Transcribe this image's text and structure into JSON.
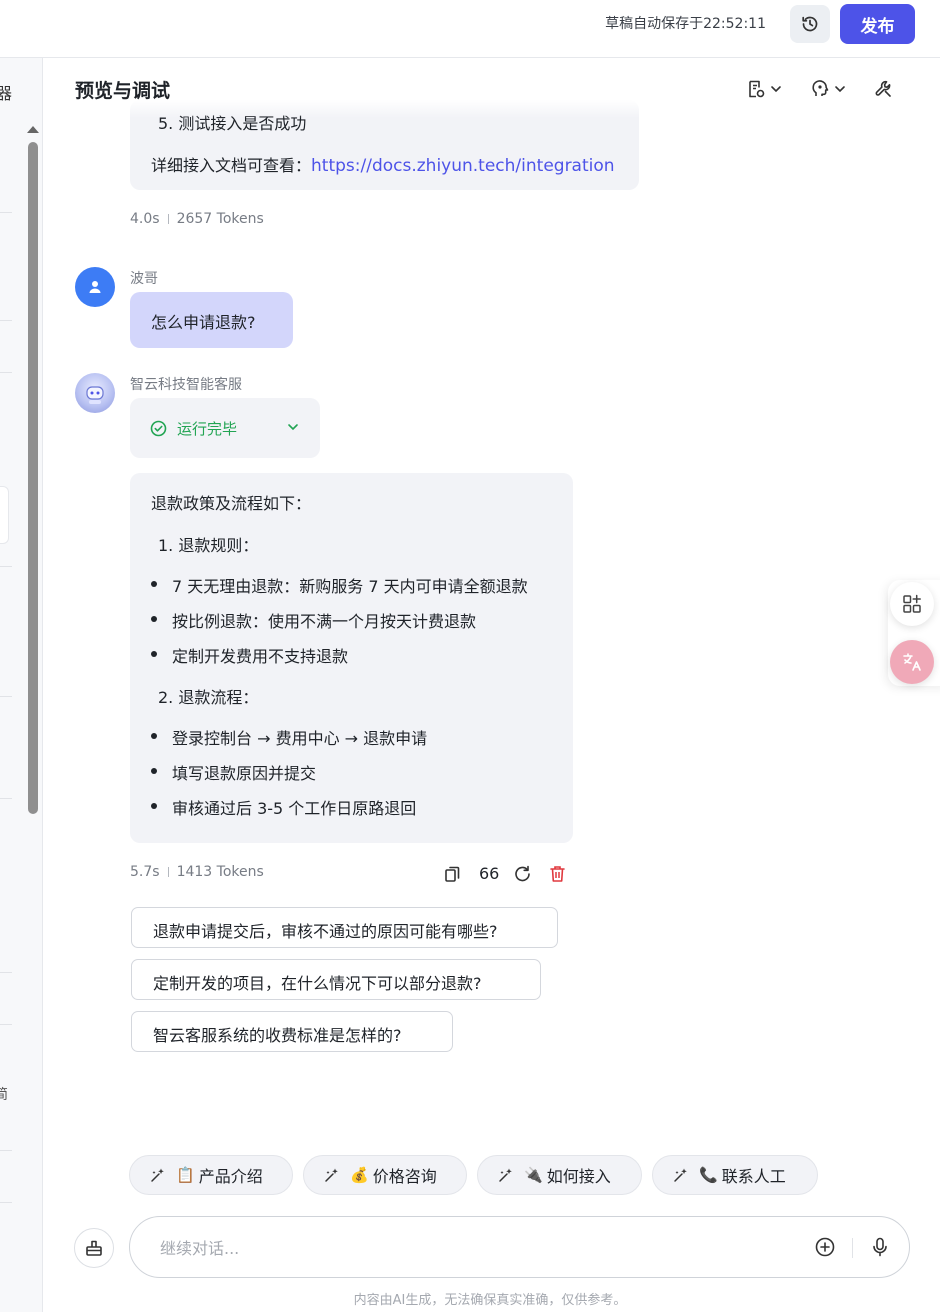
{
  "topbar": {
    "autosave_text": "草稿自动保存于22:52:11",
    "publish_label": "发布"
  },
  "left_strip": {
    "top_glyph": "器",
    "bottom_glyph": "简"
  },
  "preview": {
    "title": "预览与调试"
  },
  "prev_message": {
    "partial_step": "5. 测试接入是否成功",
    "doc_prefix": "详细接入文档可查看：",
    "doc_link": "https://docs.zhiyun.tech/integration",
    "time": "4.0s",
    "tokens": "2657 Tokens"
  },
  "user_message": {
    "sender": "波哥",
    "text": "怎么申请退款?"
  },
  "bot_message": {
    "sender": "智云科技智能客服",
    "status": "运行完毕",
    "intro": "退款政策及流程如下：",
    "section1_title": "1. 退款规则：",
    "section1_items": [
      "7 天无理由退款：新购服务 7 天内可申请全额退款",
      "按比例退款：使用不满一个月按天计费退款",
      "定制开发费用不支持退款"
    ],
    "section2_title": "2. 退款流程：",
    "section2_items": [
      "登录控制台 → 费用中心 → 退款申请",
      "填写退款原因并提交",
      "审核通过后 3-5 个工作日原路退回"
    ],
    "time": "5.7s",
    "tokens": "1413 Tokens",
    "quote_label": "66"
  },
  "suggestions": [
    "退款申请提交后，审核不通过的原因可能有哪些?",
    "定制开发的项目，在什么情况下可以部分退款?",
    "智云客服系统的收费标准是怎样的?"
  ],
  "shortcuts": [
    {
      "emoji": "📋",
      "label": "产品介绍"
    },
    {
      "emoji": "💰",
      "label": "价格咨询"
    },
    {
      "emoji": "🔌",
      "label": "如何接入"
    },
    {
      "emoji": "📞",
      "label": "联系人工"
    }
  ],
  "composer": {
    "placeholder": "继续对话..."
  },
  "disclaimer": "内容由AI生成，无法确保真实准确，仅供参考。",
  "colors": {
    "accent": "#4d53e8",
    "success": "#22a453",
    "delete": "#e0383e",
    "link": "#4d53e8",
    "user_bubble": "#d3d6fb"
  }
}
